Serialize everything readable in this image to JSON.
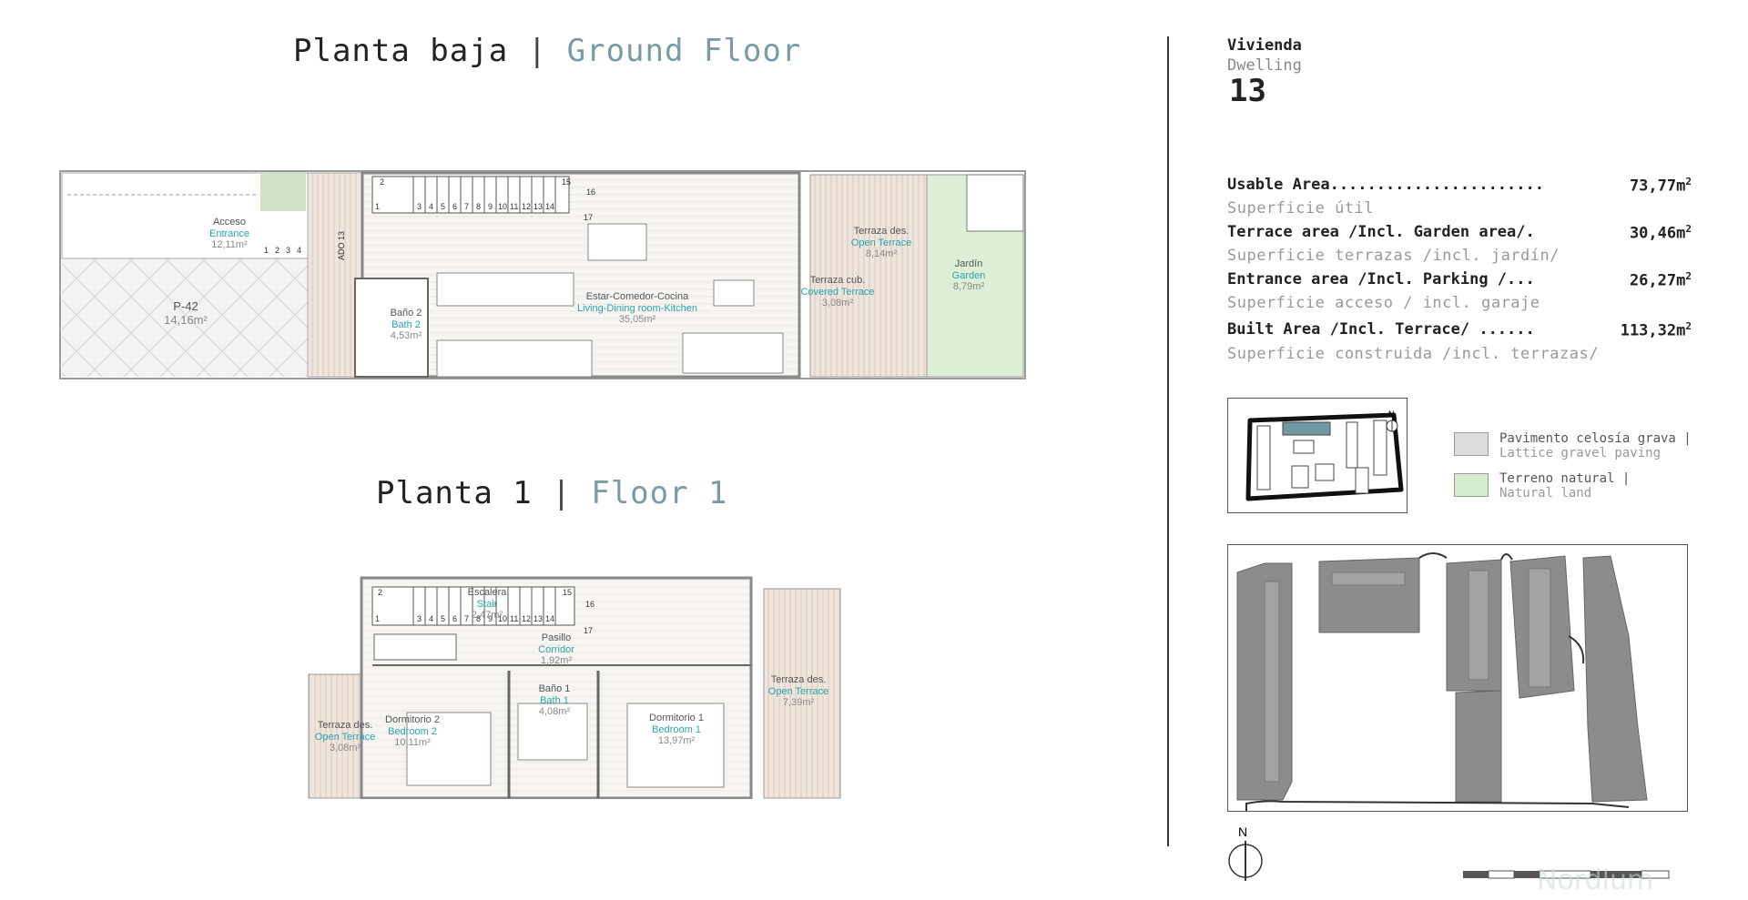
{
  "titles": {
    "ground_es": "Planta baja",
    "ground_en": "Ground Floor",
    "floor1_es": "Planta 1",
    "floor1_en": "Floor 1",
    "separator": "|"
  },
  "dwelling": {
    "label": "Vivienda",
    "sub": "Dwelling",
    "number": "13"
  },
  "areas": [
    {
      "key": "Usable Area.......................",
      "value": "73,77",
      "unit": "m",
      "sub": "Superficie útil"
    },
    {
      "key": "Terrace area /Incl. Garden area/.",
      "value": "30,46",
      "unit": "m",
      "sub": "Superficie terrazas /incl. jardín/"
    },
    {
      "key": "Entrance area /Incl. Parking /...",
      "value": "26,27",
      "unit": "m",
      "sub": "Superficie acceso / incl. garaje"
    },
    {
      "key": "Built Area /Incl. Terrace/ ......",
      "value": "113,32",
      "unit": "m",
      "sub": "Superficie construida /incl. terrazas/"
    }
  ],
  "unit_sup": "2",
  "legend": [
    {
      "es": "Pavimento celosía grava |",
      "en": "Lattice gravel paving",
      "color": "#dcdcdc"
    },
    {
      "es": "Terreno natural |",
      "en": "Natural land",
      "color": "#d6ecd0"
    }
  ],
  "north_label": "N",
  "watermark": "Nordlum",
  "ground_rooms": [
    {
      "es": "Acceso",
      "en": "Entrance",
      "area": "12,11m²"
    },
    {
      "es": "P-42",
      "en": "",
      "area": "14,16m²"
    },
    {
      "es": "Baño 2",
      "en": "Bath 2",
      "area": "4,53m²"
    },
    {
      "es": "Estar-Comedor-Cocina",
      "en": "Living-Dining room-Kitchen",
      "area": "35,05m²"
    },
    {
      "es": "Terraza des.",
      "en": "Open Terrace",
      "area": "8,14m²"
    },
    {
      "es": "Terraza cub.",
      "en": "Covered Terrace",
      "area": "3,08m²"
    },
    {
      "es": "Jardín",
      "en": "Garden",
      "area": "8,79m²"
    }
  ],
  "floor1_rooms": [
    {
      "es": "Escalera",
      "en": "Stair",
      "area": "2,47m²"
    },
    {
      "es": "Pasillo",
      "en": "Corridor",
      "area": "1,92m²"
    },
    {
      "es": "Baño 1",
      "en": "Bath 1",
      "area": "4,08m²"
    },
    {
      "es": "Dormitorio 2",
      "en": "Bedroom 2",
      "area": "10,11m²"
    },
    {
      "es": "Dormitorio 1",
      "en": "Bedroom 1",
      "area": "13,97m²"
    },
    {
      "es": "Terraza des.",
      "en": "Open Terrace",
      "area": "3,08m²"
    },
    {
      "es": "Terraza des.",
      "en": "Open Terrace",
      "area": "7,39m²"
    }
  ],
  "ado_label": "ADO 13",
  "stair_numbers": [
    "1",
    "2",
    "3",
    "4",
    "5",
    "6",
    "7",
    "8",
    "9",
    "10",
    "11",
    "12",
    "13",
    "14",
    "15",
    "16",
    "17"
  ],
  "entrance_steps": [
    "1",
    "2",
    "3",
    "4"
  ]
}
